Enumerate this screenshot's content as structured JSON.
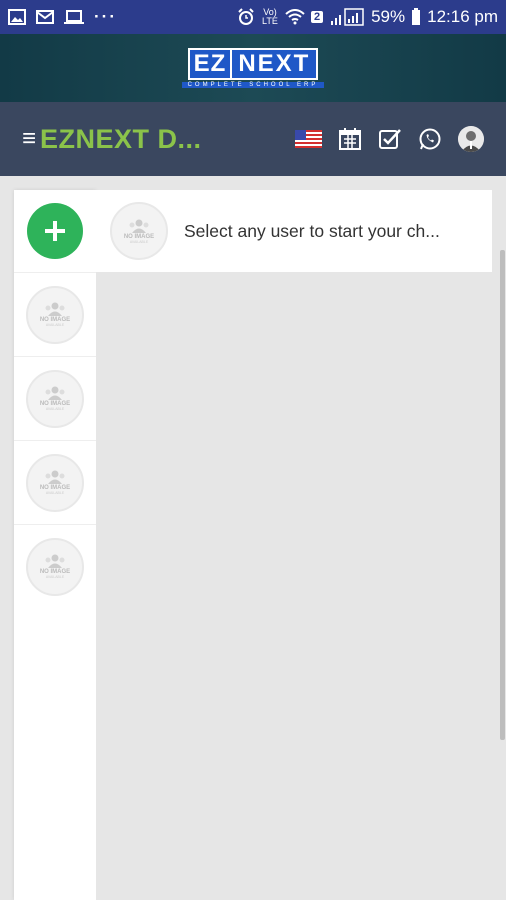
{
  "status_bar": {
    "lte_label": "Vo) LTE",
    "sim_badge": "2",
    "battery": "59%",
    "time": "12:16 pm"
  },
  "logo": {
    "ez": "EZ",
    "next": "NEXT",
    "tagline": "COMPLETE SCHOOL ERP"
  },
  "appbar": {
    "menu_glyph": "≡",
    "title": "EZNEXT D..."
  },
  "header": {
    "prompt": "Select any user to start your ch..."
  },
  "placeholder": {
    "no_image": "NO IMAGE",
    "available": "AVAILABLE"
  },
  "colors": {
    "status_bar": "#2c3c8c",
    "appbar": "#3a475f",
    "title": "#8bc34a",
    "add_button": "#2eb35a",
    "chat_bg": "#e6e6e6"
  }
}
